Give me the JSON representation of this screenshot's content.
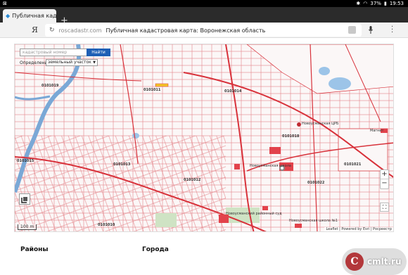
{
  "status_bar": {
    "notification_text": "⊠",
    "battery": "37%",
    "time": "19:53"
  },
  "tabs": [
    {
      "title": "Публичная кадаст"
    }
  ],
  "address_bar": {
    "browser_letter": "Я",
    "domain": "roscadastr.com",
    "page_title": "Публичная кадастровая карта: Воронежская область"
  },
  "map": {
    "search_placeholder": "кадастровый номер",
    "find_button": "Найти",
    "define_label": "Определение:",
    "define_value": "земельный участок",
    "zoom_in": "+",
    "zoom_out": "−",
    "scale": "100 m",
    "attribution": "Leaflet | Powered by Esri | Росреестр",
    "labels": [
      "0101019",
      "0101014",
      "0101011",
      "0101018",
      "0101015",
      "0101021",
      "0101012",
      "0101013",
      "0101022",
      "0101010",
      "Новоусманская ЦРБ",
      "Новоусманская школа",
      "Новоусманская школа №1",
      "Новоусманский районный суд",
      "Магнит"
    ]
  },
  "sections": {
    "districts": "Районы",
    "cities": "Города"
  },
  "watermark": {
    "letter": "C",
    "text": "cmlt.ru"
  },
  "colors": {
    "accent": "#1e5fb5",
    "cadastre_line": "#d8313a",
    "toolbar": "#2b2b2b"
  }
}
